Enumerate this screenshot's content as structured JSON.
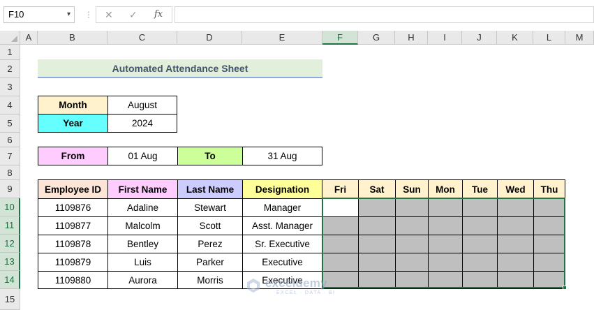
{
  "formula_bar": {
    "name_box": "F10",
    "cancel_icon": "✕",
    "enter_icon": "✓",
    "function_icon": "fx",
    "formula": ""
  },
  "columns": [
    "A",
    "B",
    "C",
    "D",
    "E",
    "F",
    "G",
    "H",
    "I",
    "J",
    "K",
    "L",
    "M"
  ],
  "rows": [
    "1",
    "2",
    "3",
    "4",
    "5",
    "6",
    "7",
    "8",
    "9",
    "10",
    "11",
    "12",
    "13",
    "14",
    "15"
  ],
  "selected_cell": "F10",
  "sheet": {
    "title": "Automated Attendance Sheet",
    "month_label": "Month",
    "month_value": "August",
    "year_label": "Year",
    "year_value": "2024",
    "from_label": "From",
    "from_value": "01 Aug",
    "to_label": "To",
    "to_value": "31 Aug",
    "headers": [
      "Employee ID",
      "First Name",
      "Last Name",
      "Designation"
    ],
    "days": [
      "Fri",
      "Sat",
      "Sun",
      "Mon",
      "Tue",
      "Wed",
      "Thu"
    ],
    "employees": [
      {
        "id": "1109876",
        "first": "Adaline",
        "last": "Stewart",
        "designation": "Manager"
      },
      {
        "id": "1109877",
        "first": "Malcolm",
        "last": "Scott",
        "designation": "Asst. Manager"
      },
      {
        "id": "1109878",
        "first": "Bentley",
        "last": "Perez",
        "designation": "Sr. Executive"
      },
      {
        "id": "1109879",
        "first": "Luis",
        "last": "Parker",
        "designation": "Executive"
      },
      {
        "id": "1109880",
        "first": "Aurora",
        "last": "Morris",
        "designation": "Executive"
      }
    ]
  },
  "colors": {
    "month_fill": "#fff2cc",
    "year_fill": "#66ffff",
    "from_fill": "#ffccff",
    "to_fill": "#ccff99",
    "employee_id_fill": "#fce4d6",
    "first_name_fill": "#ffccff",
    "last_name_fill": "#ccccff",
    "designation_fill": "#ffff99",
    "day_fill": "#fff2cc",
    "gray_fill": "#bfbfbf",
    "selection": "#217346"
  },
  "watermark": {
    "name": "exceldemy",
    "tagline": "EXCEL · DATA · BI"
  }
}
